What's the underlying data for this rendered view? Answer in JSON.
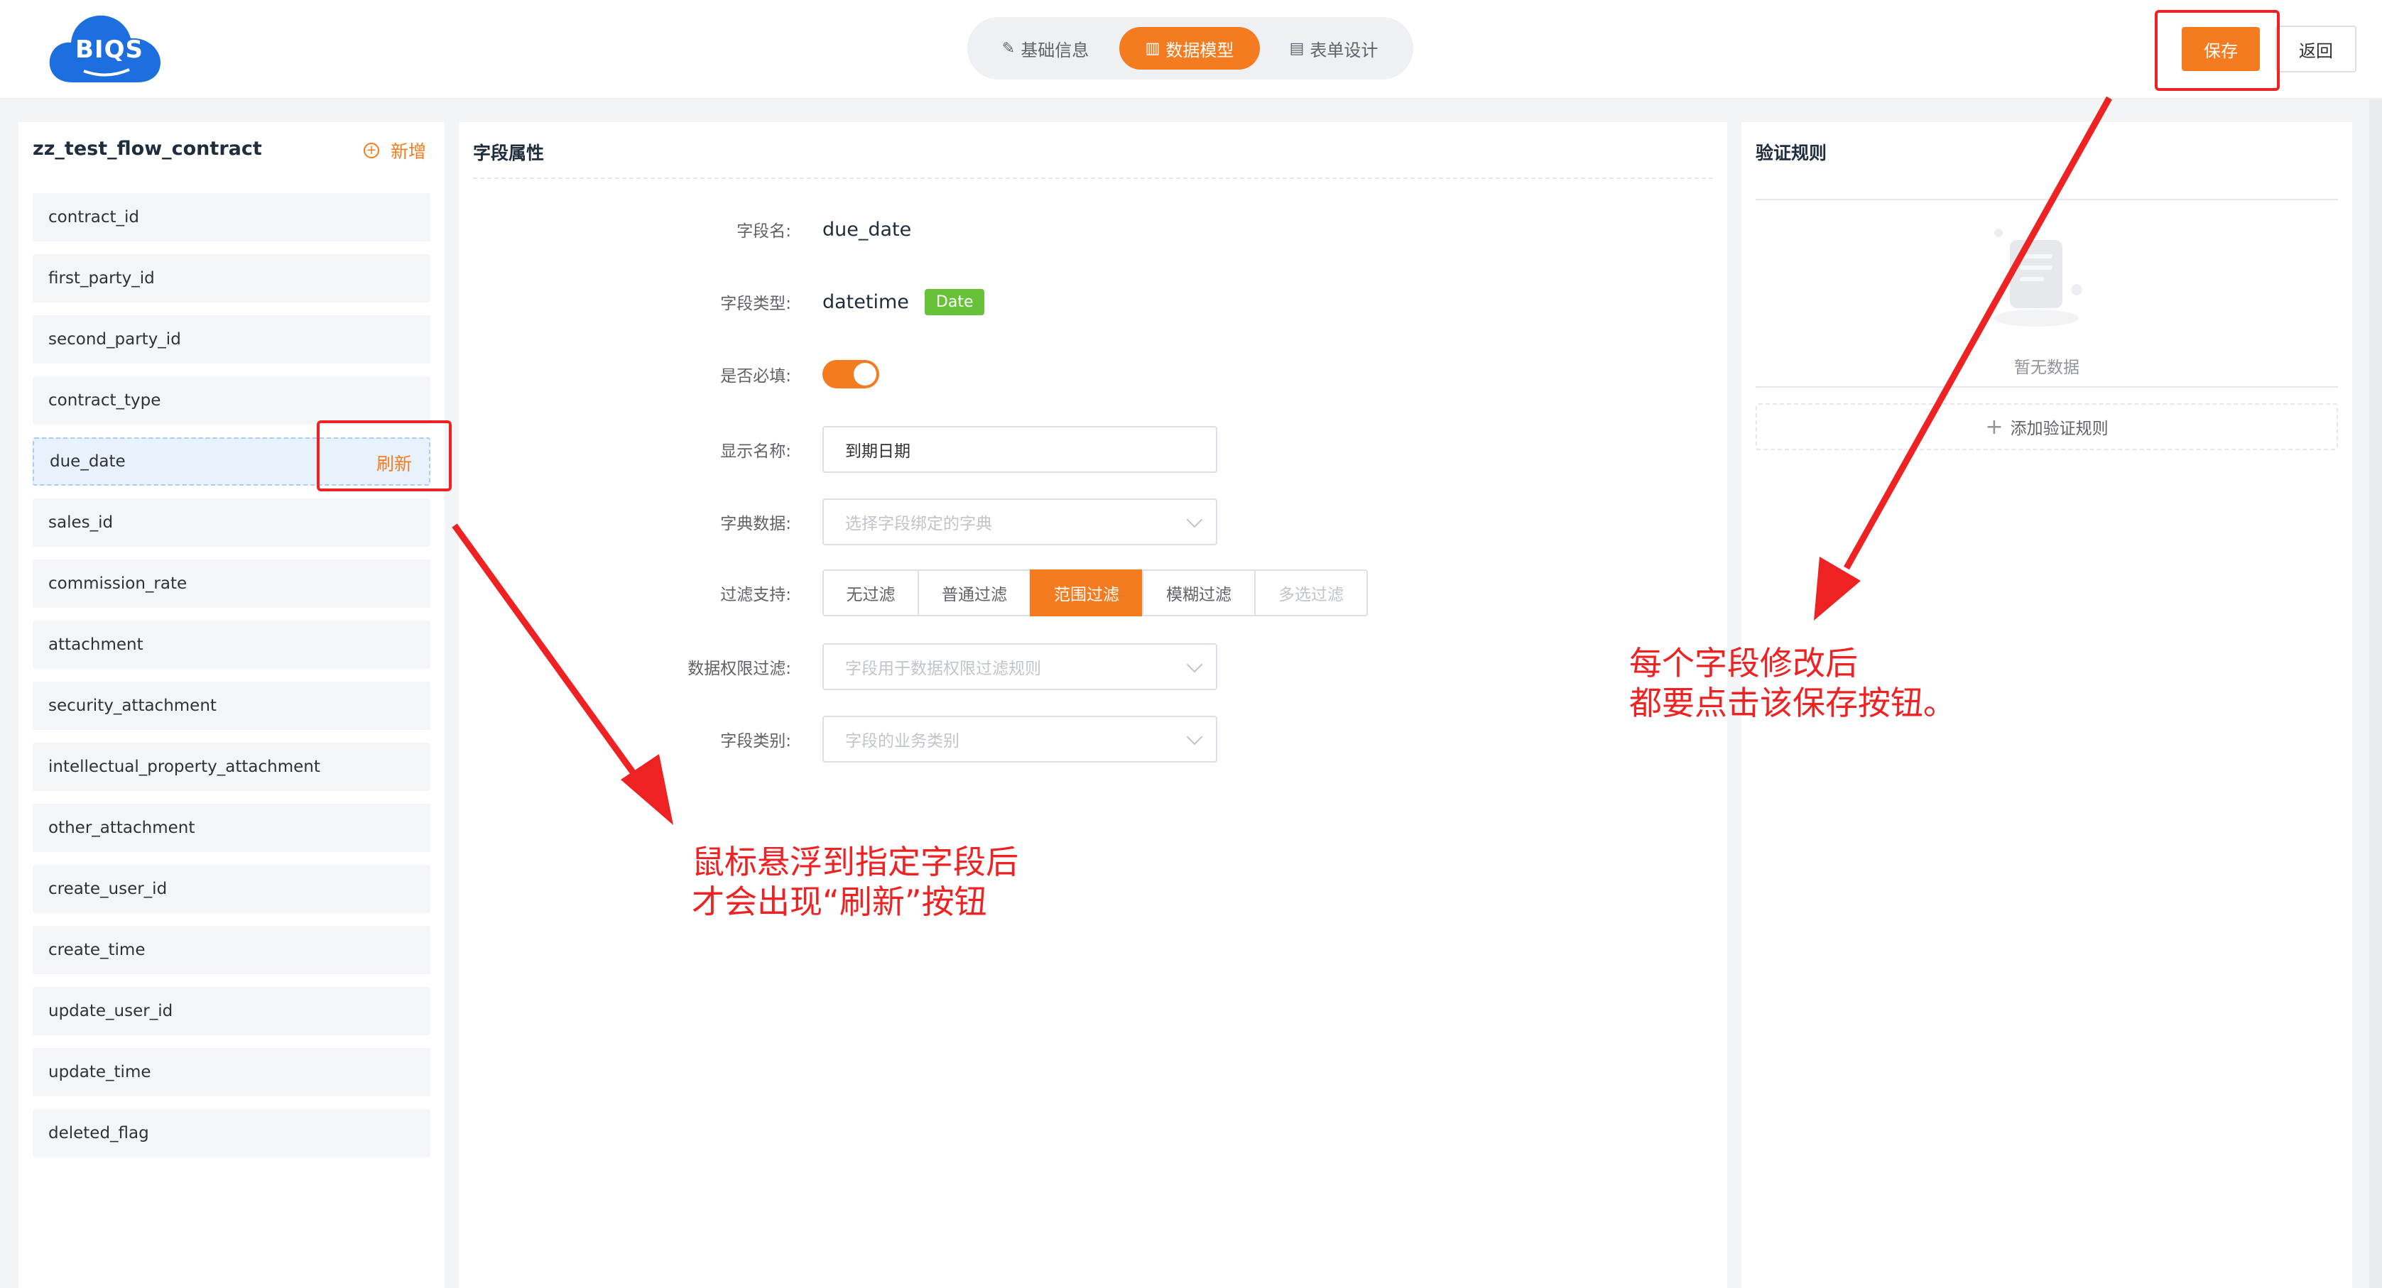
{
  "header": {
    "logo_text": "BIQS",
    "steps": [
      {
        "label": "基础信息",
        "active": false
      },
      {
        "label": "数据模型",
        "active": true
      },
      {
        "label": "表单设计",
        "active": false
      }
    ],
    "save_label": "保存",
    "back_label": "返回"
  },
  "left": {
    "title": "zz_test_flow_contract",
    "add_label": "新增",
    "refresh_label": "刷新",
    "fields": [
      "contract_id",
      "first_party_id",
      "second_party_id",
      "contract_type",
      "due_date",
      "sales_id",
      "commission_rate",
      "attachment",
      "security_attachment",
      "intellectual_property_attachment",
      "other_attachment",
      "create_user_id",
      "create_time",
      "update_user_id",
      "update_time",
      "deleted_flag"
    ],
    "active_field": "due_date"
  },
  "middle": {
    "title": "字段属性",
    "field_name_label": "字段名:",
    "field_name": "due_date",
    "field_type_label": "字段类型:",
    "field_type": "datetime",
    "field_type_tag": "Date",
    "required_label": "是否必填:",
    "required": true,
    "display_name_label": "显示名称:",
    "display_name": "到期日期",
    "dict_label": "字典数据:",
    "dict_placeholder": "选择字段绑定的字典",
    "filter_label": "过滤支持:",
    "filter_options": [
      "无过滤",
      "普通过滤",
      "范围过滤",
      "模糊过滤",
      "多选过滤"
    ],
    "filter_selected": "范围过滤",
    "perm_label": "数据权限过滤:",
    "perm_placeholder": "字段用于数据权限过滤规则",
    "category_label": "字段类别:",
    "category_placeholder": "字段的业务类别"
  },
  "right": {
    "title": "验证规则",
    "empty_text": "暂无数据",
    "add_rule_label": "添加验证规则"
  },
  "annotations": {
    "note_refresh_1": "鼠标悬浮到指定字段后",
    "note_refresh_2": "才会出现“刷新”按钮",
    "note_save_1": "每个字段修改后",
    "note_save_2": "都要点击该保存按钮。"
  },
  "colors": {
    "accent": "#f47b20",
    "date_tag": "#67c23a",
    "annotation": "#ee2222"
  }
}
